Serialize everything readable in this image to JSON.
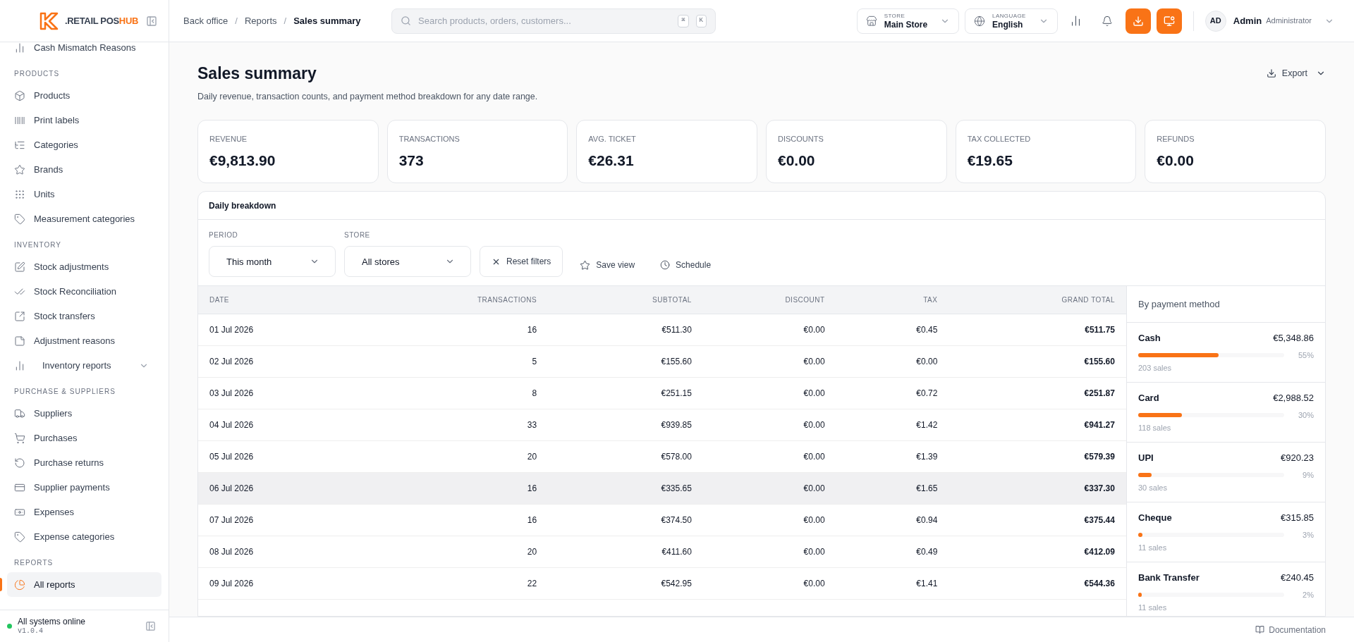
{
  "logo": {
    "text": ".RETAIL POS",
    "accent": "HUB"
  },
  "sidebar": {
    "sections": [
      {
        "items": [
          {
            "label": "Cash Mismatch Reasons",
            "selected": false
          }
        ]
      },
      {
        "heading": "PRODUCTS",
        "items": [
          {
            "label": "Products",
            "selected": false
          },
          {
            "label": "Print labels",
            "selected": false
          },
          {
            "label": "Categories",
            "selected": false
          },
          {
            "label": "Brands",
            "selected": false
          },
          {
            "label": "Units",
            "selected": false
          },
          {
            "label": "Measurement categories",
            "selected": false
          }
        ]
      },
      {
        "heading": "INVENTORY",
        "items": [
          {
            "label": "Stock adjustments",
            "selected": false
          },
          {
            "label": "Stock Reconciliation",
            "selected": false
          },
          {
            "label": "Stock transfers",
            "selected": false
          },
          {
            "label": "Adjustment reasons",
            "selected": false
          },
          {
            "label": "Inventory reports",
            "selected": false,
            "expanded": false
          }
        ]
      },
      {
        "heading": "PURCHASE & SUPPLIERS",
        "items": [
          {
            "label": "Suppliers",
            "selected": false
          },
          {
            "label": "Purchases",
            "selected": false
          },
          {
            "label": "Purchase returns",
            "selected": false
          },
          {
            "label": "Supplier payments",
            "selected": false
          },
          {
            "label": "Expenses",
            "selected": false
          },
          {
            "label": "Expense categories",
            "selected": false
          }
        ]
      },
      {
        "heading": "REPORTS",
        "items": [
          {
            "label": "All reports",
            "selected": true
          }
        ]
      }
    ],
    "status": {
      "label": "All systems online",
      "version": "v1.0.4",
      "color": "#22c55e"
    }
  },
  "topbar": {
    "separator": "/",
    "breadcrumbs": [
      {
        "label": "Back office",
        "current": false
      },
      {
        "label": "Reports",
        "current": false
      },
      {
        "label": "Sales summary",
        "current": true
      }
    ],
    "search": {
      "placeholder": "Search products, orders, customers...",
      "keys": [
        "⌘",
        "K"
      ]
    },
    "store": {
      "label": "STORE",
      "value": "Main Store"
    },
    "language": {
      "label": "LANGUAGE",
      "value": "English"
    },
    "user": {
      "initials": "AD",
      "name": "Admin",
      "role": "Administrator"
    }
  },
  "header": {
    "title": "Sales summary",
    "subtitle": "Daily revenue, transaction counts, and payment method breakdown for any date range.",
    "export": "Export"
  },
  "kpis": [
    {
      "label": "REVENUE",
      "value": "€9,813.90"
    },
    {
      "label": "TRANSACTIONS",
      "value": "373"
    },
    {
      "label": "AVG. TICKET",
      "value": "€26.31"
    },
    {
      "label": "DISCOUNTS",
      "value": "€0.00"
    },
    {
      "label": "TAX COLLECTED",
      "value": "€19.65"
    },
    {
      "label": "REFUNDS",
      "value": "€0.00"
    }
  ],
  "breakdown": {
    "title": "Daily breakdown",
    "filters": [
      {
        "label": "PERIOD",
        "value": "This month"
      },
      {
        "label": "STORE",
        "value": "All stores"
      }
    ],
    "reset": "Reset filters",
    "save_view": "Save view",
    "schedule": "Schedule",
    "columns": [
      "DATE",
      "TRANSACTIONS",
      "SUBTOTAL",
      "DISCOUNT",
      "TAX",
      "GRAND TOTAL"
    ],
    "rows": [
      {
        "cells": [
          "01 Jul 2026",
          "16",
          "€511.30",
          "€0.00",
          "€0.45",
          "€511.75"
        ],
        "selected": false
      },
      {
        "cells": [
          "02 Jul 2026",
          "5",
          "€155.60",
          "€0.00",
          "€0.00",
          "€155.60"
        ],
        "selected": false
      },
      {
        "cells": [
          "03 Jul 2026",
          "8",
          "€251.15",
          "€0.00",
          "€0.72",
          "€251.87"
        ],
        "selected": false
      },
      {
        "cells": [
          "04 Jul 2026",
          "33",
          "€939.85",
          "€0.00",
          "€1.42",
          "€941.27"
        ],
        "selected": false
      },
      {
        "cells": [
          "05 Jul 2026",
          "20",
          "€578.00",
          "€0.00",
          "€1.39",
          "€579.39"
        ],
        "selected": false
      },
      {
        "cells": [
          "06 Jul 2026",
          "16",
          "€335.65",
          "€0.00",
          "€1.65",
          "€337.30"
        ],
        "selected": true
      },
      {
        "cells": [
          "07 Jul 2026",
          "16",
          "€374.50",
          "€0.00",
          "€0.94",
          "€375.44"
        ],
        "selected": false
      },
      {
        "cells": [
          "08 Jul 2026",
          "20",
          "€411.60",
          "€0.00",
          "€0.49",
          "€412.09"
        ],
        "selected": false
      },
      {
        "cells": [
          "09 Jul 2026",
          "22",
          "€542.95",
          "€0.00",
          "€1.41",
          "€544.36"
        ],
        "selected": false
      }
    ],
    "payments": {
      "title": "By payment method",
      "methods": [
        {
          "name": "Cash",
          "amount": "€5,348.86",
          "percent": "55%",
          "sales": "203 sales",
          "level": 0.55
        },
        {
          "name": "Card",
          "amount": "€2,988.52",
          "percent": "30%",
          "sales": "118 sales",
          "level": 0.3
        },
        {
          "name": "UPI",
          "amount": "€920.23",
          "percent": "9%",
          "sales": "30 sales",
          "level": 0.09
        },
        {
          "name": "Cheque",
          "amount": "€315.85",
          "percent": "3%",
          "sales": "11 sales",
          "level": 0.03
        },
        {
          "name": "Bank Transfer",
          "amount": "€240.45",
          "percent": "2%",
          "sales": "11 sales",
          "level": 0.02
        }
      ]
    }
  },
  "footer": {
    "link": "Documentation"
  }
}
